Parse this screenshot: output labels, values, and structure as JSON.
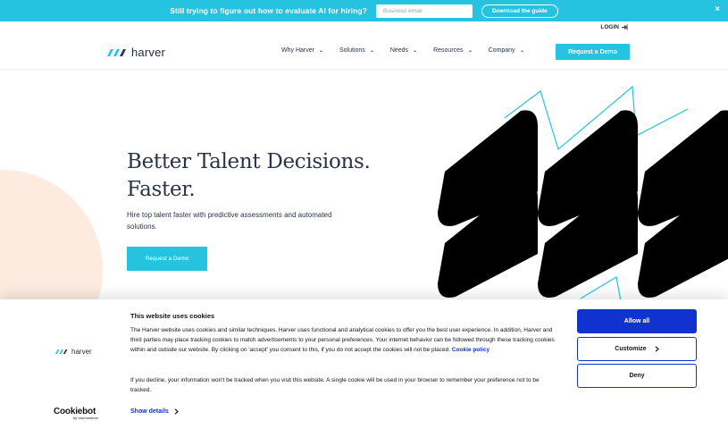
{
  "banner": {
    "message": "Still trying to figure out how to evaluate AI for hiring?",
    "email_placeholder": "Business email",
    "download_label": "Download the guide",
    "close_glyph": "×"
  },
  "header": {
    "login_label": "LOGIN",
    "logo_text": "harver",
    "nav": [
      {
        "label": "Why Harver"
      },
      {
        "label": "Solutions"
      },
      {
        "label": "Needs"
      },
      {
        "label": "Resources"
      },
      {
        "label": "Company"
      }
    ],
    "cta_label": "Request a Demo"
  },
  "hero": {
    "title_line1": "Better Talent Decisions.",
    "title_line2": "Faster.",
    "subtitle": "Hire top talent faster with predictive assessments and automated solutions.",
    "cta_label": "Request a Demo"
  },
  "cookie": {
    "logo_text": "harver",
    "title": "This website uses cookies",
    "body": "The Harver website uses cookies and similar techniques. Harver uses functional and analytical cookies to offer you the best user experience. In addition, Harver and third parties may place tracking cookies to match advertisements to your personal preferences. Your internet behavior can be followed through these tracking cookies within and outside our website. By clicking on 'accept' you consent to this, if you do not accept the cookies will not be placed.",
    "policy_link": "Cookie policy",
    "body2": "If you decline, your information won't be tracked when you visit this website. A single cookie will be used in your browser to remember your preference not to be tracked.",
    "details_label": "Show details",
    "allow_label": "Allow all",
    "customize_label": "Customize",
    "deny_label": "Deny",
    "cookiebot_brand": "Cookiebot",
    "cookiebot_by": "by Usercentrics"
  },
  "colors": {
    "accent": "#26c3e0",
    "consent_blue": "#1032cf",
    "peach": "#fdebe0",
    "text_dark": "#2a3348"
  },
  "icons": [
    "login-arrow-icon",
    "chevron-down-icon",
    "chevron-right-icon",
    "close-icon",
    "harver-logo-mark"
  ]
}
